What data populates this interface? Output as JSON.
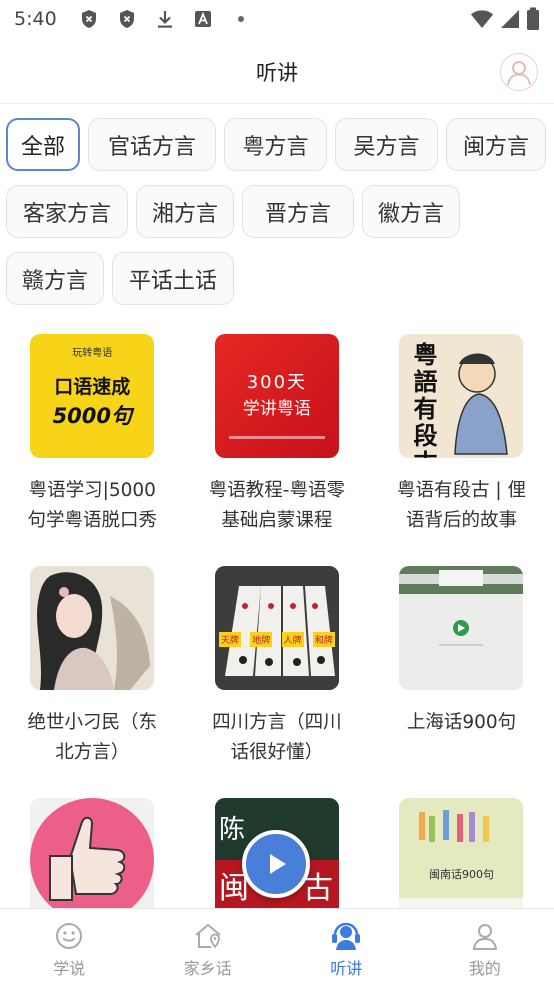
{
  "status_bar": {
    "time": "5:40",
    "left_icons": [
      "shield-x-icon",
      "shield-x-icon",
      "download-icon",
      "font-a-icon",
      "dot-icon"
    ],
    "right_icons": [
      "wifi-icon",
      "signal-icon",
      "battery-icon"
    ]
  },
  "header": {
    "title": "听讲"
  },
  "categories": [
    {
      "label": "全部",
      "selected": true
    },
    {
      "label": "官话方言"
    },
    {
      "label": "粤方言"
    },
    {
      "label": "吴方言"
    },
    {
      "label": "闽方言"
    },
    {
      "label": "客家方言"
    },
    {
      "label": "湘方言"
    },
    {
      "label": "晋方言"
    },
    {
      "label": "徽方言"
    },
    {
      "label": "赣方言"
    },
    {
      "label": "平话土话"
    }
  ],
  "thumbnail_text": {
    "c1_brand": "玩转粤语",
    "c1_line1": "口语速成",
    "c1_line2": "5000句",
    "c2_line1": "300天",
    "c2_line2": "学讲粤语",
    "c3_text": "粤語有段古",
    "c5_tiles": [
      "天牌",
      "地牌",
      "人牌",
      "和牌"
    ],
    "c9_text": "闽南话900句"
  },
  "cards": [
    {
      "title": "粤语学习|5000句学粤语脱口秀"
    },
    {
      "title": "粤语教程-粤语零基础启蒙课程"
    },
    {
      "title": "粤语有段古 | 俚语背后的故事"
    },
    {
      "title": "绝世小刁民（东北方言）"
    },
    {
      "title": "四川方言（四川话很好懂）"
    },
    {
      "title": "上海话900句"
    },
    {
      "title": ""
    },
    {
      "title": ""
    },
    {
      "title": ""
    }
  ],
  "bottom_nav": [
    {
      "label": "学说",
      "icon": "smile-icon"
    },
    {
      "label": "家乡话",
      "icon": "home-pin-icon"
    },
    {
      "label": "听讲",
      "icon": "headset-icon",
      "active": true
    },
    {
      "label": "我的",
      "icon": "user-icon"
    }
  ],
  "colors": {
    "accent": "#3c7be0",
    "chip_active_border": "#5f86c8",
    "play_button": "#4a7fd9"
  }
}
